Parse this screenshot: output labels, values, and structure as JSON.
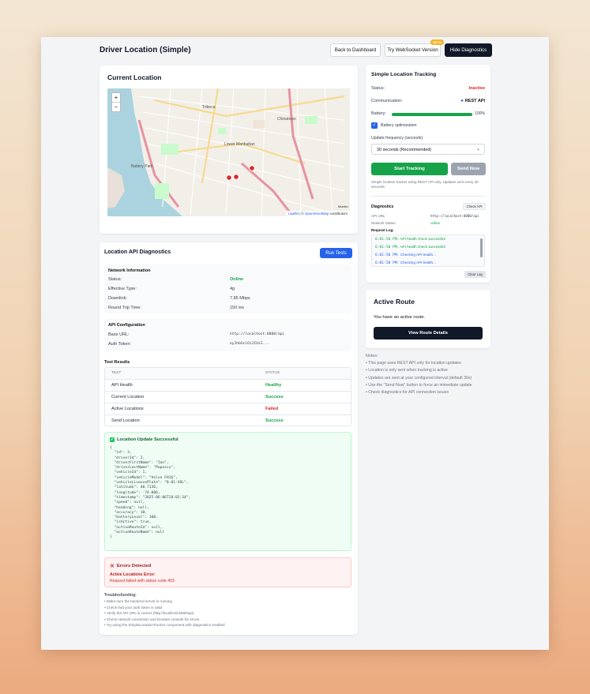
{
  "header": {
    "title": "Driver Location (Simple)",
    "back_label": "Back to Dashboard",
    "websocket_label": "Try WebSocket Version",
    "beta_label": "BETA",
    "hide_diag_label": "Hide Diagnostics"
  },
  "current_location": {
    "title": "Current Location",
    "zoom_in": "+",
    "zoom_out": "−",
    "attribution_leaflet": "Leaflet",
    "attribution_sep": " | © ",
    "attribution_osm": "OpenStreetMap",
    "attribution_tail": " contributors",
    "map_labels": [
      "Lower Manhattan",
      "Battery Park",
      "Chinatown",
      "Tribeca"
    ],
    "map_corner_label": "Mueller"
  },
  "api_diag": {
    "title": "Location API Diagnostics",
    "run_tests_label": "Run Tests",
    "network": {
      "heading": "Network Information",
      "rows": [
        {
          "label": "Status:",
          "value": "Online"
        },
        {
          "label": "Effective Type:",
          "value": "4g"
        },
        {
          "label": "Downlink:",
          "value": "7.85 Mbps"
        },
        {
          "label": "Round Trip Time:",
          "value": "150 ms"
        }
      ]
    },
    "api_config": {
      "heading": "API Configuration",
      "rows": [
        {
          "label": "Base URL:",
          "value": "http://localhost:8080/api"
        },
        {
          "label": "Auth Token:",
          "value": "eyJhbGciOiJIUzI..."
        }
      ]
    },
    "test_results": {
      "heading": "Test Results",
      "col_test": "TEST",
      "col_status": "STATUS",
      "rows": [
        {
          "test": "API Health",
          "status": "Healthy"
        },
        {
          "test": "Current Location",
          "status": "Success"
        },
        {
          "test": "Active Locations",
          "status": "Failed"
        },
        {
          "test": "Send Location",
          "status": "Success"
        }
      ]
    },
    "success_box": {
      "title": "Location Update Successful",
      "json_lines": [
        "{",
        "  \"id\": 3,",
        "  \"driverId\": 2,",
        "  \"driverFirstName\": \"Ion\",",
        "  \"driverLastName\": \"Popescu\",",
        "  \"vehicleId\": 1,",
        "  \"vehicleModel\": \"Volvo FH16\",",
        "  \"vehicleLicensePlate\": \"B-01-VOL\",",
        "  \"latitude\": 40.7136,",
        "  \"longitude\": -74.006,",
        "  \"timestamp\": \"2025-06-06T18:02:34\",",
        "  \"speed\": null,",
        "  \"heading\": null,",
        "  \"accuracy\": 10,",
        "  \"batteryLevel\": 100,",
        "  \"isActive\": true,",
        "  \"activeRouteId\": null,",
        "  \"activeRouteName\": null",
        "}"
      ]
    },
    "error_box": {
      "title": "Errors Detected",
      "label": "Active Locations Error:",
      "message": "Request failed with status code 403"
    },
    "troubleshooting": {
      "heading": "Troubleshooting:",
      "items": [
        "Make sure the backend server is running",
        "Check that your auth token is valid",
        "Verify the API URL is correct (http://localhost:8080/api)",
        "Check network connection and browser console for errors",
        "Try using the SimpleLocationTracker component with diagnostics enabled"
      ]
    }
  },
  "tracking": {
    "title": "Simple Location Tracking",
    "status_label": "Status:",
    "status_value": "Inactive",
    "comm_label": "Communication:",
    "comm_value": "REST API",
    "battery_label": "Battery:",
    "battery_value": "100%",
    "battery_level": 1.0,
    "battery_opt_label": "Battery optimization",
    "freq_label": "Update frequency (seconds)",
    "freq_selected": "30 seconds (Recommended)",
    "start_label": "Start Tracking",
    "send_label": "Send Now",
    "desc": "Simple location tracker using REST API only. Updates sent every 30 seconds.",
    "diagnostics": {
      "title": "Diagnostics",
      "check_api_label": "Check API",
      "api_url_label": "API URL:",
      "api_url_value": "http://localhost:8080/api",
      "net_status_label": "Network Status:",
      "net_status_value": "online",
      "request_log_label": "Request Log:",
      "log": [
        {
          "time": "6:01:50 PM:",
          "msg": "API health check successful",
          "kind": "ok"
        },
        {
          "time": "6:01:50 PM:",
          "msg": "API health check successful",
          "kind": "ok"
        },
        {
          "time": "6:01:50 PM:",
          "msg": "Checking API health...",
          "kind": "info"
        },
        {
          "time": "6:01:50 PM:",
          "msg": "Checking API health...",
          "kind": "info"
        }
      ],
      "clear_log_label": "Clear Log"
    }
  },
  "active_route": {
    "title": "Active Route",
    "text": "You have an active route.",
    "button_label": "View Route Details"
  },
  "notes": {
    "heading": "Notes:",
    "items": [
      "This page uses REST API only for location updates",
      "Location is only sent when tracking is active",
      "Updates are sent at your configured interval (default 30s)",
      "Use the \"Send Now\" button to force an immediate update",
      "Check diagnostics for API connection issues"
    ]
  },
  "colors": {
    "accent_blue": "#2563eb",
    "success_green": "#16a34a",
    "danger_red": "#dc2626",
    "dark_button": "#111827",
    "start_green": "#16a34a"
  }
}
